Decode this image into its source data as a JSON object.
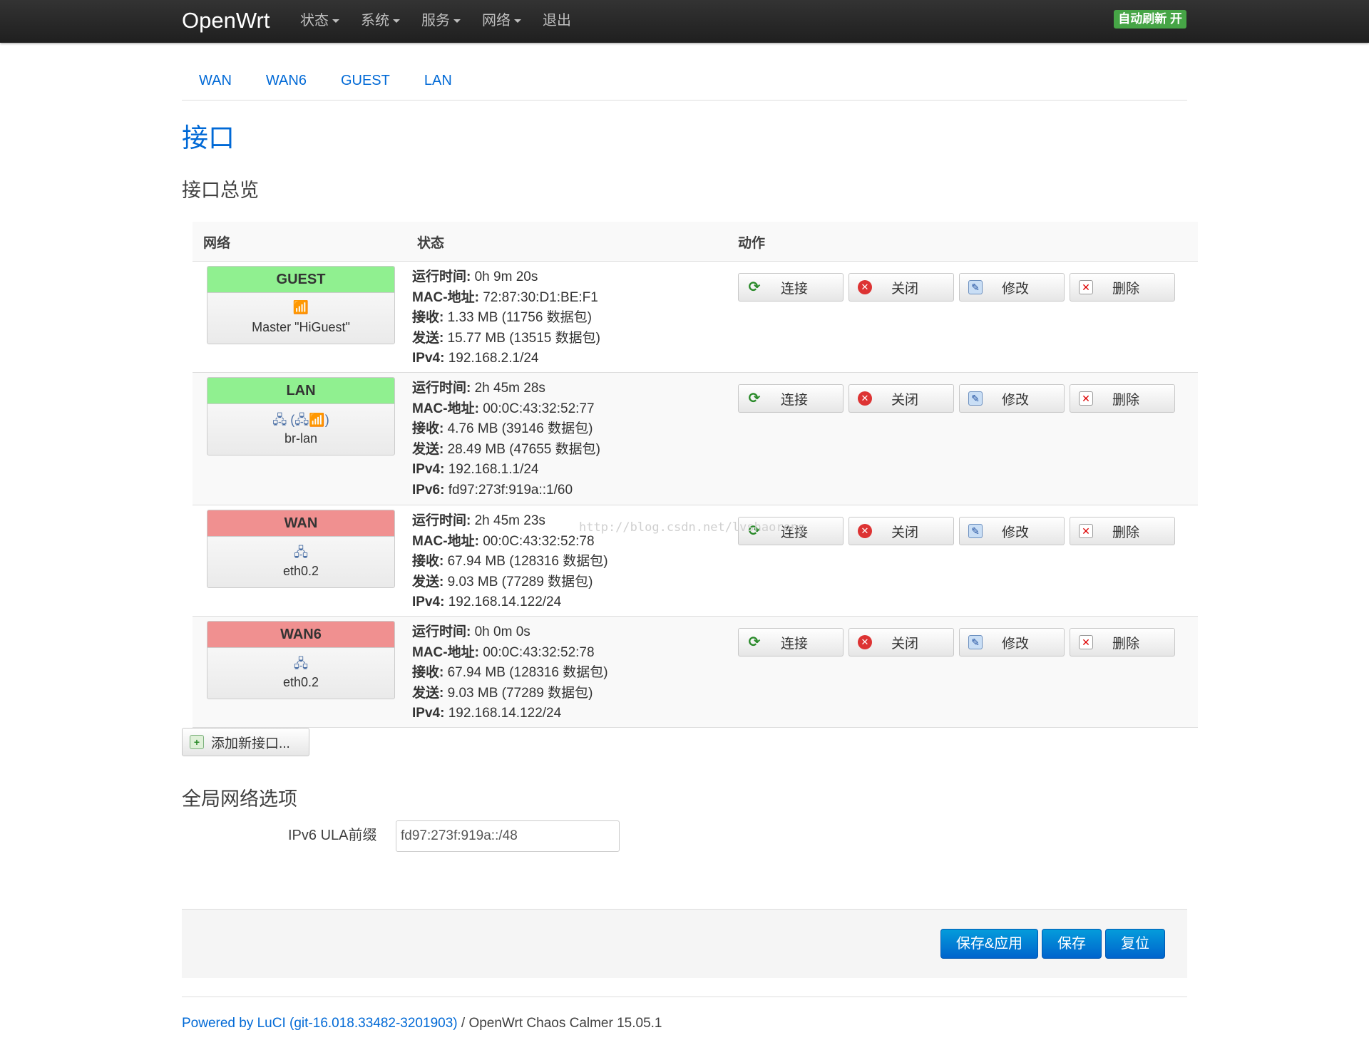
{
  "brand": "OpenWrt",
  "nav": [
    {
      "label": "状态",
      "dropdown": true
    },
    {
      "label": "系统",
      "dropdown": true
    },
    {
      "label": "服务",
      "dropdown": true
    },
    {
      "label": "网络",
      "dropdown": true
    },
    {
      "label": "退出",
      "dropdown": false
    }
  ],
  "autorefresh": "自动刷新 开",
  "tabs": [
    "WAN",
    "WAN6",
    "GUEST",
    "LAN"
  ],
  "page_title": "接口",
  "overview_title": "接口总览",
  "table_headers": {
    "network": "网络",
    "status": "状态",
    "actions": "动作"
  },
  "action_labels": {
    "connect": "连接",
    "stop": "关闭",
    "edit": "修改",
    "delete": "删除"
  },
  "interfaces": [
    {
      "name": "GUEST",
      "state_color": "#90f090",
      "device_icons": "wifi-icon",
      "device": "Master \"HiGuest\"",
      "status": [
        {
          "k": "运行时间:",
          "v": " 0h 9m 20s"
        },
        {
          "k": "MAC-地址:",
          "v": " 72:87:30:D1:BE:F1"
        },
        {
          "k": "接收:",
          "v": " 1.33 MB (11756 数据包)"
        },
        {
          "k": "发送:",
          "v": " 15.77 MB (13515 数据包)"
        },
        {
          "k": "IPv4:",
          "v": " 192.168.2.1/24"
        }
      ]
    },
    {
      "name": "LAN",
      "state_color": "#90f090",
      "device_icons": "bridge-icon",
      "device": "br-lan",
      "status": [
        {
          "k": "运行时间:",
          "v": " 2h 45m 28s"
        },
        {
          "k": "MAC-地址:",
          "v": " 00:0C:43:32:52:77"
        },
        {
          "k": "接收:",
          "v": " 4.76 MB (39146 数据包)"
        },
        {
          "k": "发送:",
          "v": " 28.49 MB (47655 数据包)"
        },
        {
          "k": "IPv4:",
          "v": " 192.168.1.1/24"
        },
        {
          "k": "IPv6:",
          "v": " fd97:273f:919a::1/60"
        }
      ]
    },
    {
      "name": "WAN",
      "state_color": "#f09090",
      "device_icons": "ethernet-icon",
      "device": "eth0.2",
      "status": [
        {
          "k": "运行时间:",
          "v": " 2h 45m 23s"
        },
        {
          "k": "MAC-地址:",
          "v": " 00:0C:43:32:52:78"
        },
        {
          "k": "接收:",
          "v": " 67.94 MB (128316 数据包)"
        },
        {
          "k": "发送:",
          "v": " 9.03 MB (77289 数据包)"
        },
        {
          "k": "IPv4:",
          "v": " 192.168.14.122/24"
        }
      ]
    },
    {
      "name": "WAN6",
      "state_color": "#f09090",
      "device_icons": "ethernet-icon",
      "device": "eth0.2",
      "status": [
        {
          "k": "运行时间:",
          "v": " 0h 0m 0s"
        },
        {
          "k": "MAC-地址:",
          "v": " 00:0C:43:32:52:78"
        },
        {
          "k": "接收:",
          "v": " 67.94 MB (128316 数据包)"
        },
        {
          "k": "发送:",
          "v": " 9.03 MB (77289 数据包)"
        },
        {
          "k": "IPv4:",
          "v": " 192.168.14.122/24"
        }
      ]
    }
  ],
  "add_interface": "添加新接口...",
  "global_title": "全局网络选项",
  "ula_label": "IPv6 ULA前缀",
  "ula_value": "fd97:273f:919a::/48",
  "buttons": {
    "save_apply": "保存&应用",
    "save": "保存",
    "reset": "复位"
  },
  "footer": {
    "link": "Powered by LuCI (git-16.018.33482-3201903)",
    "text": " / OpenWrt Chaos Calmer 15.05.1"
  },
  "watermark": "http://blog.csdn.net/lvshaorong"
}
